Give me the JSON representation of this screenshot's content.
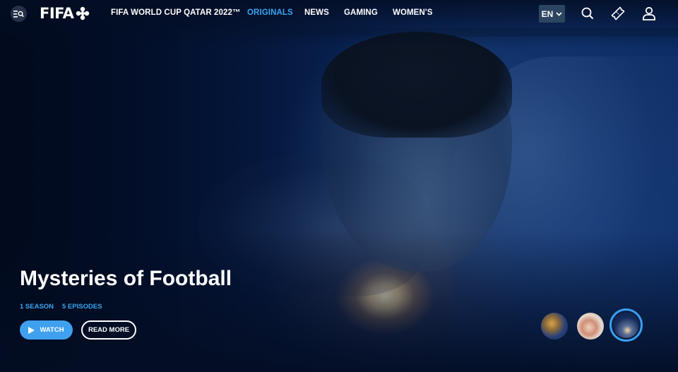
{
  "nav": {
    "menu_icon": "menu-search-icon",
    "logo_text": "FIFA",
    "links": [
      {
        "label": "FIFA WORLD CUP QATAR 2022™",
        "active": false
      },
      {
        "label": "ORIGINALS",
        "active": true
      },
      {
        "label": "NEWS",
        "active": false
      },
      {
        "label": "GAMING",
        "active": false
      },
      {
        "label": "WOMEN'S",
        "active": false
      }
    ],
    "language": "EN",
    "icons": [
      "search-icon",
      "ticket-icon",
      "user-icon"
    ]
  },
  "hero": {
    "title": "Mysteries of Football",
    "seasons": "1 SEASON",
    "episodes": "5 EPISODES",
    "watch_label": "WATCH",
    "read_more_label": "READ MORE",
    "carousel": [
      "slide-1",
      "slide-2",
      "slide-3"
    ],
    "active_slide": 3
  },
  "colors": {
    "accent": "#39a4f0",
    "button": "#3fa0ef",
    "background": "#04112a"
  }
}
